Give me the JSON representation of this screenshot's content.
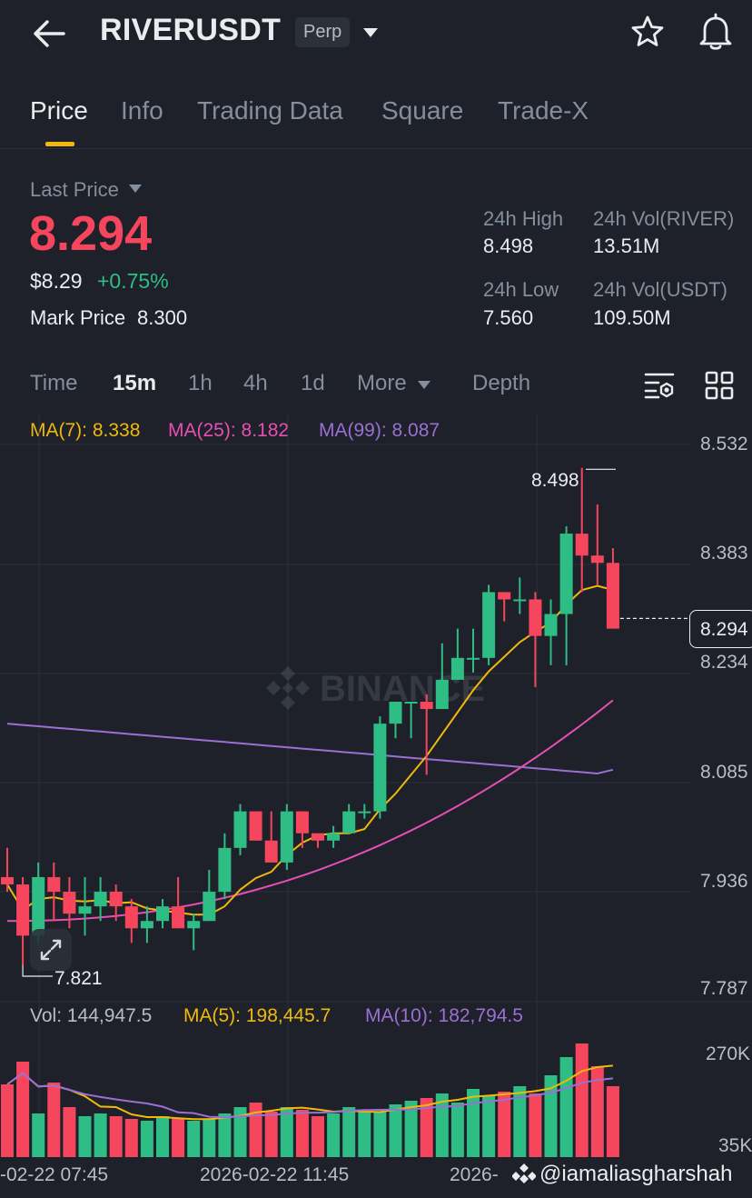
{
  "header": {
    "symbol": "RIVERUSDT",
    "badge": "Perp"
  },
  "tabs": [
    {
      "label": "Price",
      "active": true
    },
    {
      "label": "Info"
    },
    {
      "label": "Trading Data"
    },
    {
      "label": "Square"
    },
    {
      "label": "Trade-X"
    }
  ],
  "ticker": {
    "last_price_label": "Last Price",
    "last_price": "8.294",
    "usd_price": "$8.29",
    "change": "+0.75%",
    "mark_price_label": "Mark Price",
    "mark_price": "8.300",
    "high_label": "24h High",
    "high": "8.498",
    "low_label": "24h Low",
    "low": "7.560",
    "vol_base_label": "24h Vol(RIVER)",
    "vol_base": "13.51M",
    "vol_quote_label": "24h Vol(USDT)",
    "vol_quote": "109.50M"
  },
  "intervals": {
    "time": "Time",
    "m15": "15m",
    "h1": "1h",
    "h4": "4h",
    "d1": "1d",
    "more": "More",
    "depth": "Depth"
  },
  "indicators": {
    "ma7": "MA(7): 8.338",
    "ma25": "MA(25): 8.182",
    "ma99": "MA(99): 8.087",
    "vol": "Vol: 144,947.5",
    "vma5": "MA(5): 198,445.7",
    "vma10": "MA(10): 182,794.5"
  },
  "colors": {
    "up": "#2ebd85",
    "down": "#f6465d",
    "accent": "#f0b90b",
    "ma7": "#f0b90b",
    "ma25": "#e84fb4",
    "ma99": "#9b6fd4"
  },
  "watermark": "BINANCE",
  "credit": "@iamaliasgharshah",
  "chart_data": {
    "type": "candlestick",
    "interval": "15m",
    "price_axis_ticks": [
      "8.532",
      "8.383",
      "8.234",
      "8.085",
      "7.936",
      "7.787"
    ],
    "volume_axis_ticks": [
      "270K",
      "35K"
    ],
    "time_labels": [
      "-02-22 07:45",
      "2026-02-22 11:45",
      "2026-"
    ],
    "high_marker": "8.498",
    "low_marker": "7.821",
    "current_price_tag": "8.294",
    "candles": [
      {
        "o": 7.94,
        "h": 7.98,
        "l": 7.92,
        "c": 7.93
      },
      {
        "o": 7.93,
        "h": 7.94,
        "l": 7.82,
        "c": 7.86
      },
      {
        "o": 7.86,
        "h": 7.96,
        "l": 7.85,
        "c": 7.94
      },
      {
        "o": 7.94,
        "h": 7.96,
        "l": 7.88,
        "c": 7.92
      },
      {
        "o": 7.92,
        "h": 7.94,
        "l": 7.87,
        "c": 7.89
      },
      {
        "o": 7.89,
        "h": 7.94,
        "l": 7.86,
        "c": 7.9
      },
      {
        "o": 7.9,
        "h": 7.94,
        "l": 7.88,
        "c": 7.92
      },
      {
        "o": 7.92,
        "h": 7.93,
        "l": 7.88,
        "c": 7.9
      },
      {
        "o": 7.9,
        "h": 7.91,
        "l": 7.85,
        "c": 7.87
      },
      {
        "o": 7.87,
        "h": 7.9,
        "l": 7.85,
        "c": 7.88
      },
      {
        "o": 7.88,
        "h": 7.91,
        "l": 7.87,
        "c": 7.9
      },
      {
        "o": 7.9,
        "h": 7.94,
        "l": 7.87,
        "c": 7.87
      },
      {
        "o": 7.87,
        "h": 7.89,
        "l": 7.84,
        "c": 7.88
      },
      {
        "o": 7.88,
        "h": 7.95,
        "l": 7.88,
        "c": 7.92
      },
      {
        "o": 7.92,
        "h": 8.0,
        "l": 7.91,
        "c": 7.98
      },
      {
        "o": 7.98,
        "h": 8.04,
        "l": 7.97,
        "c": 8.03
      },
      {
        "o": 8.03,
        "h": 8.03,
        "l": 7.99,
        "c": 7.99
      },
      {
        "o": 7.99,
        "h": 8.03,
        "l": 7.96,
        "c": 7.96
      },
      {
        "o": 7.96,
        "h": 8.04,
        "l": 7.95,
        "c": 8.03
      },
      {
        "o": 8.03,
        "h": 8.03,
        "l": 7.98,
        "c": 8.0
      },
      {
        "o": 8.0,
        "h": 8.0,
        "l": 7.98,
        "c": 7.99
      },
      {
        "o": 7.99,
        "h": 8.01,
        "l": 7.98,
        "c": 8.0
      },
      {
        "o": 8.0,
        "h": 8.04,
        "l": 8.0,
        "c": 8.03
      },
      {
        "o": 8.03,
        "h": 8.04,
        "l": 8.02,
        "c": 8.03
      },
      {
        "o": 8.03,
        "h": 8.16,
        "l": 8.02,
        "c": 8.15
      },
      {
        "o": 8.15,
        "h": 8.18,
        "l": 8.13,
        "c": 8.18
      },
      {
        "o": 8.18,
        "h": 8.18,
        "l": 8.13,
        "c": 8.18
      },
      {
        "o": 8.18,
        "h": 8.19,
        "l": 8.08,
        "c": 8.17
      },
      {
        "o": 8.17,
        "h": 8.26,
        "l": 8.17,
        "c": 8.21
      },
      {
        "o": 8.21,
        "h": 8.28,
        "l": 8.22,
        "c": 8.24
      },
      {
        "o": 8.24,
        "h": 8.28,
        "l": 8.22,
        "c": 8.24
      },
      {
        "o": 8.24,
        "h": 8.34,
        "l": 8.23,
        "c": 8.33
      },
      {
        "o": 8.33,
        "h": 8.32,
        "l": 8.29,
        "c": 8.32
      },
      {
        "o": 8.32,
        "h": 8.35,
        "l": 8.3,
        "c": 8.32
      },
      {
        "o": 8.32,
        "h": 8.33,
        "l": 8.2,
        "c": 8.27
      },
      {
        "o": 8.27,
        "h": 8.32,
        "l": 8.23,
        "c": 8.3
      },
      {
        "o": 8.3,
        "h": 8.42,
        "l": 8.23,
        "c": 8.41
      },
      {
        "o": 8.41,
        "h": 8.5,
        "l": 8.33,
        "c": 8.38
      },
      {
        "o": 8.38,
        "h": 8.45,
        "l": 8.34,
        "c": 8.37
      },
      {
        "o": 8.37,
        "h": 8.39,
        "l": 8.28,
        "c": 8.28
      }
    ],
    "volumes": [
      80,
      105,
      48,
      82,
      55,
      45,
      48,
      45,
      42,
      40,
      45,
      42,
      40,
      42,
      48,
      55,
      60,
      50,
      55,
      52,
      45,
      48,
      55,
      50,
      50,
      58,
      62,
      65,
      70,
      60,
      75,
      68,
      72,
      78,
      70,
      90,
      110,
      125,
      100,
      78
    ],
    "ma7_last": 8.338,
    "ma25_last": 8.182,
    "ma99_last": 8.087
  }
}
